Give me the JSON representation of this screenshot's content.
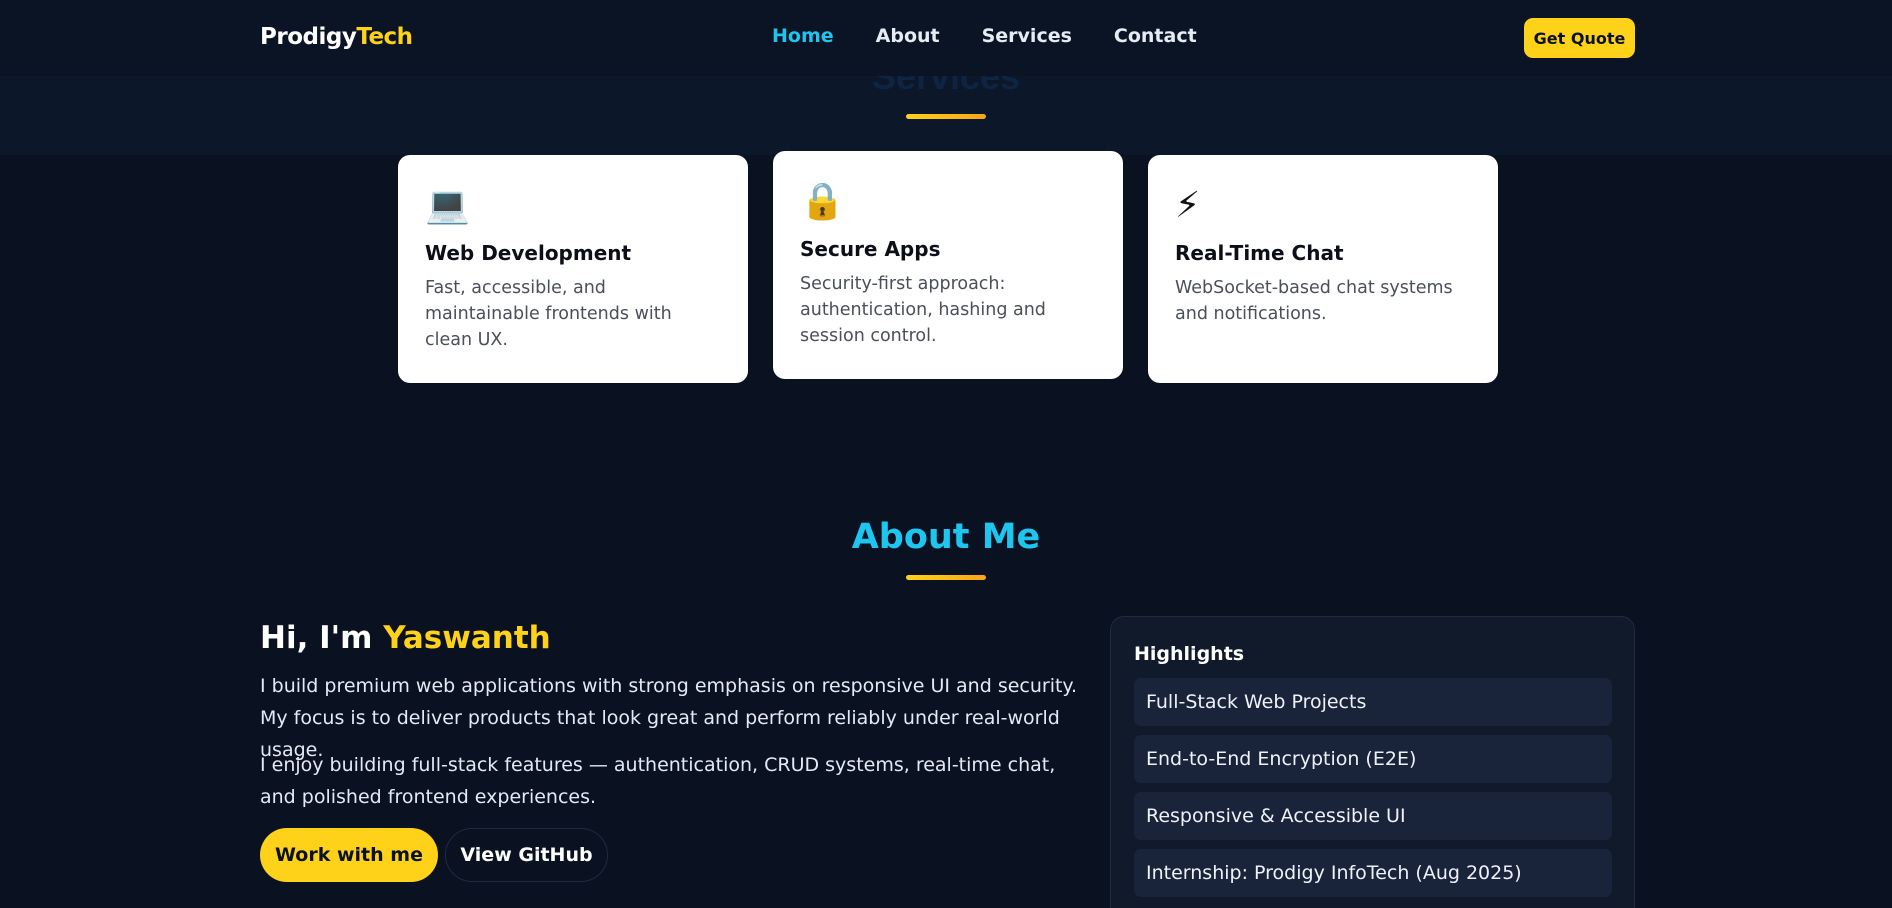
{
  "nav": {
    "brand_main": "Prodigy",
    "brand_accent": "Tech",
    "links": [
      "Home",
      "About",
      "Services",
      "Contact"
    ],
    "active": "Home",
    "cta": "Get Quote"
  },
  "services": {
    "title": "Services",
    "cards": [
      {
        "icon": "💻",
        "icon_name": "laptop-icon",
        "title": "Web Development",
        "desc": "Fast, accessible, and maintainable frontends with clean UX."
      },
      {
        "icon": "🔒",
        "icon_name": "lock-icon",
        "title": "Secure Apps",
        "desc": "Security-first approach: authentication, hashing and session control."
      },
      {
        "icon": "⚡",
        "icon_name": "lightning-icon",
        "title": "Real-Time Chat",
        "desc": "WebSocket-based chat systems and notifications."
      }
    ]
  },
  "about": {
    "title": "About Me",
    "greeting_prefix": "Hi, I'm",
    "name": "Yaswanth",
    "paragraph1": "I build premium web applications with strong emphasis on responsive UI and security. My focus is to deliver products that look great and perform reliably under real-world usage.",
    "paragraph2": "I enjoy building full-stack features — authentication, CRUD systems, real-time chat, and polished frontend experiences.",
    "primary_button": "Work with me",
    "secondary_button": "View GitHub"
  },
  "highlights": {
    "title": "Highlights",
    "items": [
      "Full-Stack Web Projects",
      "End-to-End Encryption (E2E)",
      "Responsive & Accessible UI",
      "Internship: Prodigy InfoTech (Aug 2025)"
    ]
  },
  "colors": {
    "background": "#0a1222",
    "accent_yellow": "#ffd21a",
    "accent_cyan": "#1ec6ef"
  }
}
